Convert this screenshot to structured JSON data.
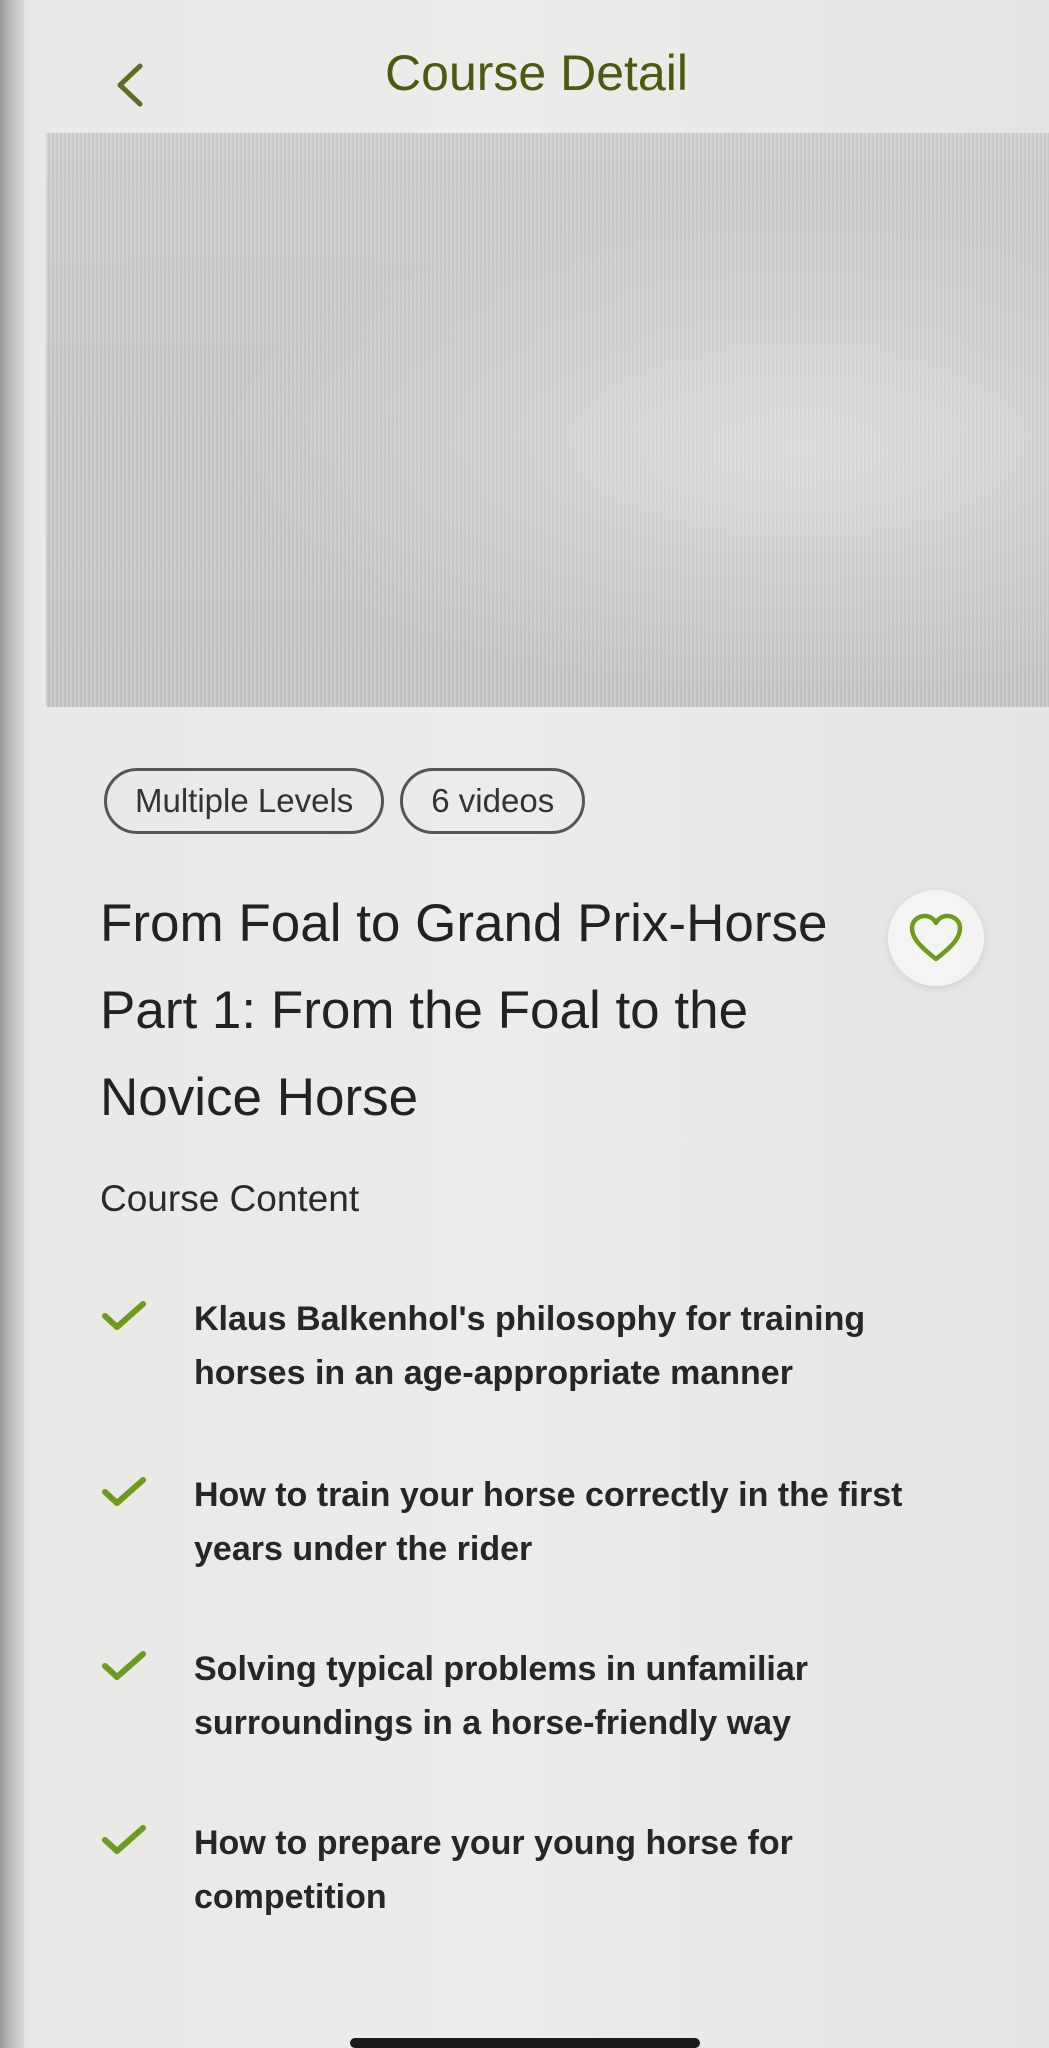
{
  "header": {
    "title": "Course Detail",
    "back_icon": "chevron-left-icon"
  },
  "tags": [
    "Multiple Levels",
    "6 videos"
  ],
  "course": {
    "title": "From Foal to Grand Prix-Horse Part 1: From the Foal to the Novice Horse",
    "favorite_icon": "heart-icon"
  },
  "course_content": {
    "heading": "Course Content",
    "items": [
      "Klaus Balkenhol's philosophy for training horses in an age-appropriate manner",
      "How to train your horse correctly in the first years under the rider",
      "Solving typical problems in unfamiliar surroundings in a horse-friendly way",
      "How to prepare your young horse for competition"
    ]
  },
  "colors": {
    "accent": "#6e9a1e",
    "title_text": "#4a5a0e"
  }
}
